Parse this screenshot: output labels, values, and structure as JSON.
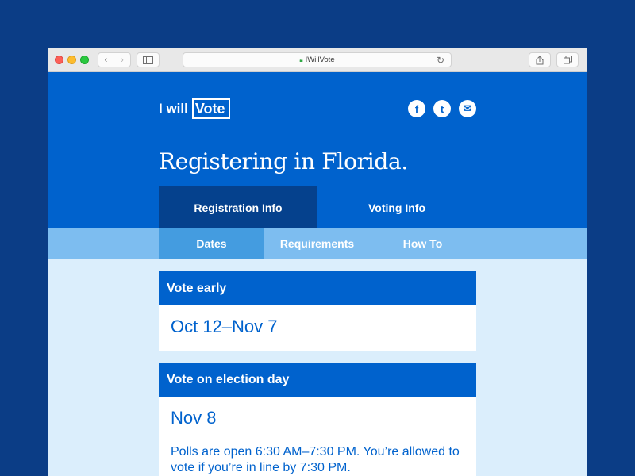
{
  "browser": {
    "url": "IWillVote",
    "icons": {
      "back": "chevron-left-icon",
      "forward": "chevron-right-icon",
      "sidebar": "sidebar-icon",
      "lock": "lock-icon",
      "reload": "reload-icon",
      "share": "share-icon",
      "tabs": "tabs-icon"
    }
  },
  "header": {
    "logo_prefix": "I will",
    "logo_word": "Vote",
    "social": [
      {
        "name": "facebook-icon",
        "glyph": "f"
      },
      {
        "name": "twitter-icon",
        "glyph": "t"
      },
      {
        "name": "email-icon",
        "glyph": "✉"
      }
    ],
    "title": "Registering in Florida."
  },
  "main_tabs": [
    {
      "label": "Registration Info",
      "active": true
    },
    {
      "label": "Voting Info",
      "active": false
    }
  ],
  "sub_tabs": [
    {
      "label": "Dates",
      "active": true
    },
    {
      "label": "Requirements",
      "active": false
    },
    {
      "label": "How To",
      "active": false
    }
  ],
  "cards": [
    {
      "title": "Vote early",
      "value": "Oct 12–Nov 7"
    },
    {
      "title": "Vote on election day",
      "value": "Nov 8",
      "note": "Polls are open 6:30 AM–7:30 PM. You’re allowed to vote if you’re in line by 7:30 PM."
    }
  ],
  "colors": {
    "page_bg": "#0b3d86",
    "header_blue": "#0062cd",
    "active_tab": "#05418d",
    "subnav": "#7dbdf0",
    "subnav_active": "#449ce0",
    "content_bg": "#dbeefc"
  }
}
